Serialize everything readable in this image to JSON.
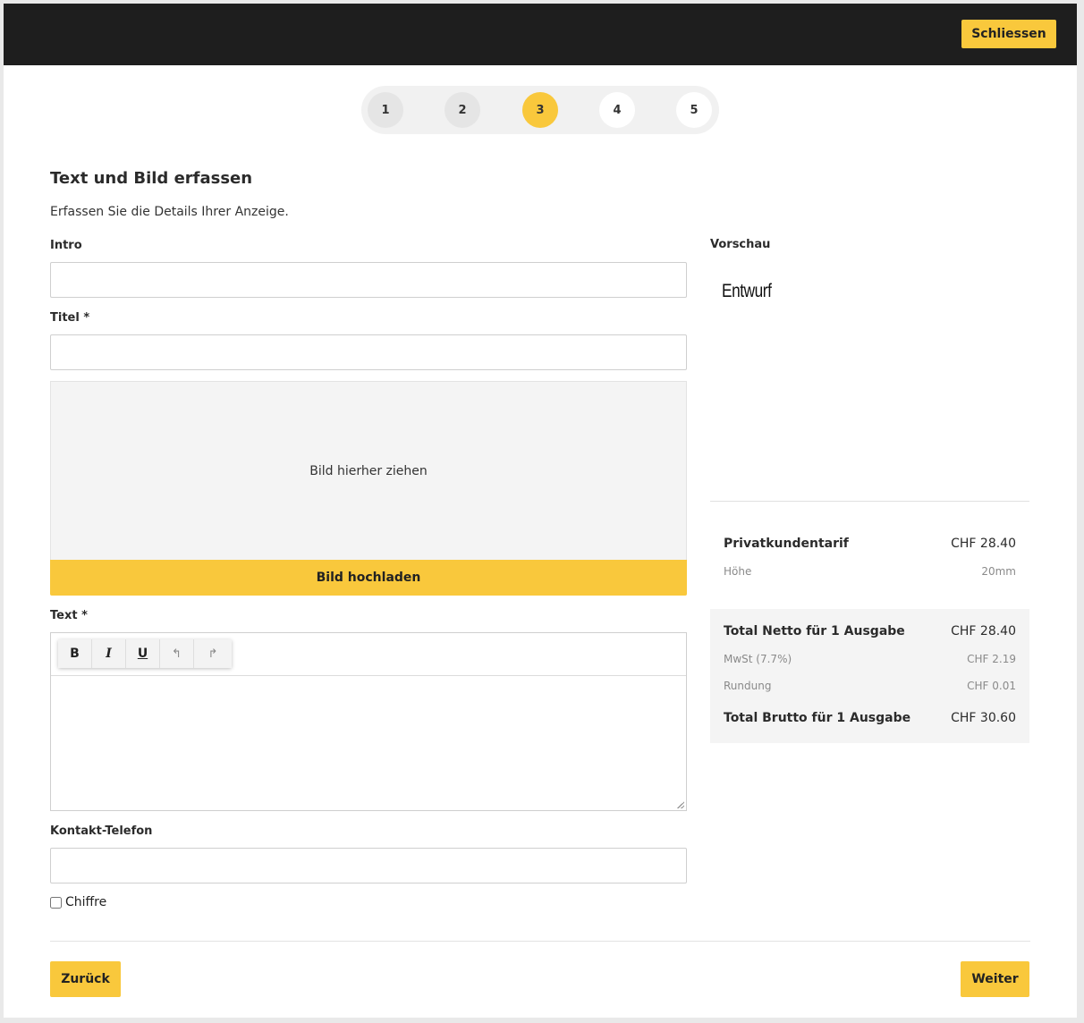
{
  "header": {
    "close_label": "Schliessen"
  },
  "stepper": {
    "steps": [
      "1",
      "2",
      "3",
      "4",
      "5"
    ],
    "active": 3
  },
  "page": {
    "title": "Text und Bild erfassen",
    "subtitle": "Erfassen Sie die Details Ihrer Anzeige."
  },
  "form": {
    "intro_label": "Intro",
    "intro_value": "",
    "title_label": "Titel *",
    "title_value": "",
    "dropzone_text": "Bild hierher ziehen",
    "upload_label": "Bild hochladen",
    "text_label": "Text *",
    "toolbar": {
      "bold": "B",
      "italic": "I",
      "underline": "U",
      "undo": "↰",
      "redo": "↱"
    },
    "phone_label": "Kontakt-Telefon",
    "phone_value": "",
    "chiffre_label": "Chiffre",
    "chiffre_checked": false
  },
  "preview": {
    "label": "Vorschau",
    "draft_text": "Entwurf"
  },
  "pricing": {
    "tariff_label": "Privatkundentarif",
    "tariff_value": "CHF 28.40",
    "height_label": "Höhe",
    "height_value": "20mm",
    "net_label": "Total Netto für 1 Ausgabe",
    "net_value": "CHF 28.40",
    "vat_label": "MwSt (7.7%)",
    "vat_value": "CHF 2.19",
    "rounding_label": "Rundung",
    "rounding_value": "CHF 0.01",
    "gross_label": "Total Brutto für 1 Ausgabe",
    "gross_value": "CHF 30.60"
  },
  "footer": {
    "back_label": "Zurück",
    "next_label": "Weiter"
  },
  "colors": {
    "accent": "#f9c83c",
    "topbar": "#1e1e1e"
  }
}
